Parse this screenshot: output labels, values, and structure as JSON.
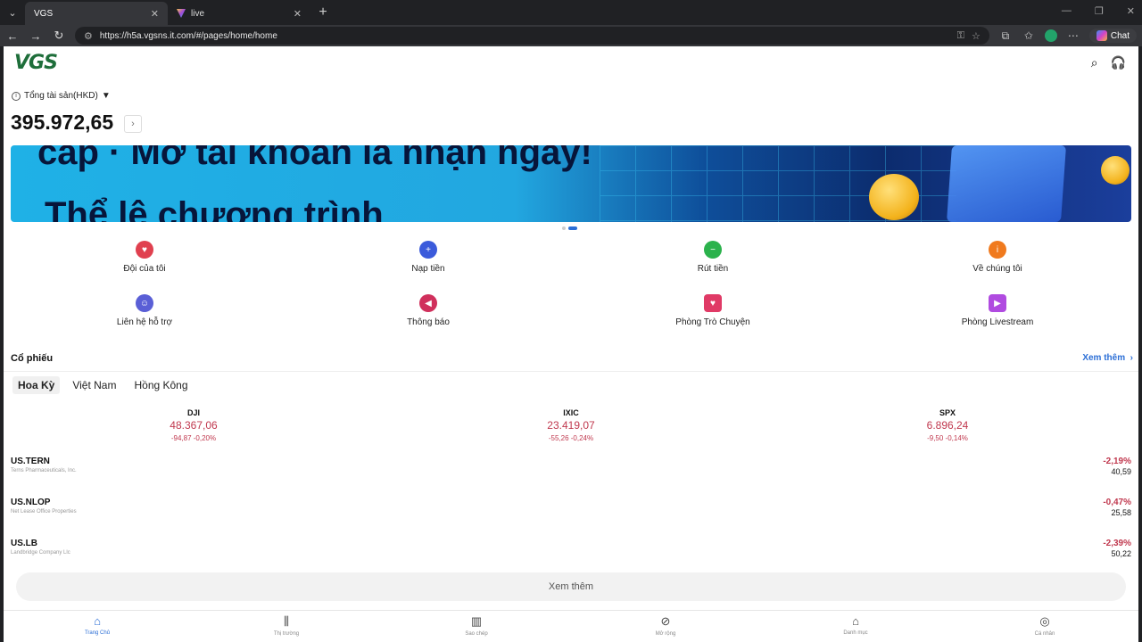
{
  "browser": {
    "tabs": [
      {
        "title": "VGS",
        "active": true
      },
      {
        "title": "live",
        "active": false
      }
    ],
    "url": "https://h5a.vgsns.it.com/#/pages/home/home",
    "chat_label": "Chat"
  },
  "header": {
    "logo_text": "VGS"
  },
  "assets": {
    "label": "Tổng tài sản(HKD)",
    "value": "395.972,65"
  },
  "banner": {
    "line1": "cấp · Mở tài khoản là nhận ngay!",
    "line2": "Thể lệ chương trình"
  },
  "shortcuts": [
    {
      "label": "Đội của tôi",
      "icon": "team-icon",
      "color": "#e0404f"
    },
    {
      "label": "Nạp tiền",
      "icon": "deposit-icon",
      "color": "#3b5bdb"
    },
    {
      "label": "Rút tiền",
      "icon": "withdraw-icon",
      "color": "#2bb24c"
    },
    {
      "label": "Về chúng tôi",
      "icon": "about-icon",
      "color": "#f07a1e"
    },
    {
      "label": "Liên hệ hỗ trợ",
      "icon": "support-icon",
      "color": "#5a5fd6"
    },
    {
      "label": "Thông báo",
      "icon": "megaphone-icon",
      "color": "#d0305c"
    },
    {
      "label": "Phòng Trò Chuyện",
      "icon": "chat-heart-icon",
      "color": "#e03a66"
    },
    {
      "label": "Phòng Livestream",
      "icon": "livestream-icon",
      "color": "#b04be0"
    }
  ],
  "stocks_section": {
    "title": "Cổ phiếu",
    "see_more": "Xem thêm",
    "tabs": [
      "Hoa Kỳ",
      "Việt Nam",
      "Hồng Kông"
    ],
    "active_tab": "Hoa Kỳ",
    "indices": [
      {
        "name": "DJI",
        "value": "48.367,06",
        "change": "-94,87 -0,20%"
      },
      {
        "name": "IXIC",
        "value": "23.419,07",
        "change": "-55,26 -0,24%"
      },
      {
        "name": "SPX",
        "value": "6.896,24",
        "change": "-9,50 -0,14%"
      }
    ],
    "rows": [
      {
        "code": "US.TERN",
        "name": "Terns Pharmaceuticals, Inc.",
        "pct": "-2,19%",
        "price": "40,59"
      },
      {
        "code": "US.NLOP",
        "name": "Net Lease Office Properties",
        "pct": "-0,47%",
        "price": "25,58"
      },
      {
        "code": "US.LB",
        "name": "Landbridge Company Llc",
        "pct": "-2,39%",
        "price": "50,22"
      }
    ],
    "more_button": "Xem thêm"
  },
  "bottom_nav": [
    {
      "label": "Trang Chủ",
      "icon": "home-icon",
      "active": true
    },
    {
      "label": "Thị trường",
      "icon": "candlestick-icon",
      "active": false
    },
    {
      "label": "Sao chép",
      "icon": "copy-chart-icon",
      "active": false
    },
    {
      "label": "Mở rộng",
      "icon": "compass-icon",
      "active": false
    },
    {
      "label": "Danh mục",
      "icon": "portfolio-icon",
      "active": false
    },
    {
      "label": "Cá nhân",
      "icon": "user-icon",
      "active": false
    }
  ]
}
